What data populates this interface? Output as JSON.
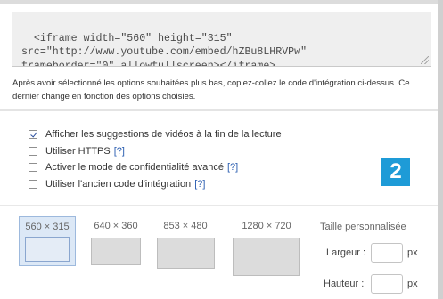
{
  "embed_code": "<iframe width=\"560\" height=\"315\"\nsrc=\"http://www.youtube.com/embed/hZBu8LHRVPw\"\nframeborder=\"0\" allowfullscreen></iframe>",
  "instructions": "Après avoir sélectionné les options souhaitées plus bas, copiez-collez le code d'intégration ci-dessus. Ce dernier change en fonction des options choisies.",
  "options": [
    {
      "label": "Afficher les suggestions de vidéos à la fin de la lecture",
      "help": "",
      "checked": true
    },
    {
      "label": "Utiliser HTTPS",
      "help": "[?]",
      "checked": false
    },
    {
      "label": "Activer le mode de confidentialité avancé",
      "help": "[?]",
      "checked": false
    },
    {
      "label": "Utiliser l'ancien code d'intégration",
      "help": "[?]",
      "checked": false
    }
  ],
  "step_badge": "2",
  "sizes": [
    {
      "label": "560 × 315",
      "selected": true
    },
    {
      "label": "640 × 360",
      "selected": false
    },
    {
      "label": "853 × 480",
      "selected": false
    },
    {
      "label": "1280 × 720",
      "selected": false
    }
  ],
  "custom_size": {
    "title": "Taille personnalisée",
    "width_label": "Largeur :",
    "height_label": "Hauteur :",
    "unit": "px",
    "width_value": "",
    "height_value": ""
  },
  "colors": {
    "badge": "#1e9bd7",
    "selected_size": "#dce8f6",
    "help_link": "#2a5db0"
  }
}
